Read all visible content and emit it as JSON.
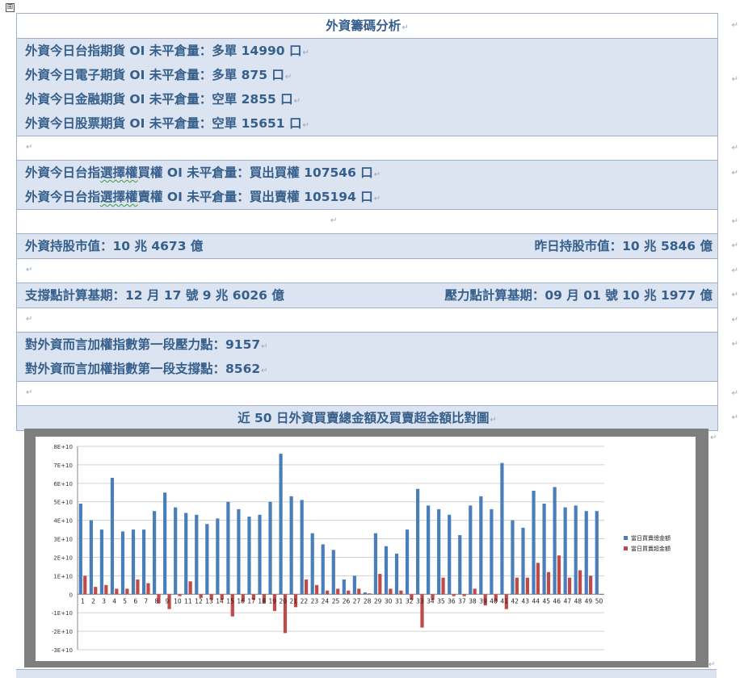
{
  "doc": {
    "move_handle": "⊞",
    "para_mark": "↵",
    "title": "外資籌碼分析",
    "futures": [
      {
        "prefix": "外資今日台指期貨 OI 未平倉量：",
        "value": "多單 14990 口"
      },
      {
        "prefix": "外資今日電子期貨 OI 未平倉量：",
        "value": "多單 875 口"
      },
      {
        "prefix": "外資今日金融期貨 OI 未平倉量：",
        "value": "空單 2855 口"
      },
      {
        "prefix": "外資今日股票期貨 OI 未平倉量：",
        "value": "空單 15651 口"
      }
    ],
    "options": [
      {
        "a": "外資今日台指",
        "b": "選擇權",
        "c": "買權 OI 未平倉量：買出買權 107546 口"
      },
      {
        "a": "外資今日台指",
        "b": "選擇權",
        "c": "賣權 OI 未平倉量：買出賣權 105194 口"
      }
    ],
    "holdings": {
      "left": "外資持股市值：10 兆 4673 億",
      "right": "昨日持股市值：10 兆 5846 億"
    },
    "base": {
      "left": "支撐點計算基期：12 月 17 號 9 兆 6026 億",
      "right": "壓力點計算基期：09 月 01 號 10 兆 1977 億"
    },
    "points": [
      "對外資而言加權指數第一段壓力點：9157",
      "對外資而言加權指數第一段支撐點：8562"
    ],
    "chart_title": "近 50 日外資買賣總金額及買賣超金額比對圖"
  },
  "chart_data": {
    "type": "bar",
    "categories": [
      "1",
      "2",
      "3",
      "4",
      "5",
      "6",
      "7",
      "8",
      "9",
      "10",
      "11",
      "12",
      "13",
      "14",
      "15",
      "16",
      "17",
      "18",
      "19",
      "20",
      "21",
      "22",
      "23",
      "24",
      "25",
      "26",
      "27",
      "28",
      "29",
      "30",
      "31",
      "32",
      "33",
      "34",
      "35",
      "36",
      "37",
      "38",
      "39",
      "40",
      "41",
      "42",
      "43",
      "44",
      "45",
      "46",
      "47",
      "48",
      "49",
      "50"
    ],
    "series": [
      {
        "name": "當日買賣總金額",
        "color": "#4a7ebb",
        "values": [
          49000000000.0,
          40000000000.0,
          35000000000.0,
          63000000000.0,
          34000000000.0,
          35000000000.0,
          35000000000.0,
          45000000000.0,
          55000000000.0,
          47000000000.0,
          44000000000.0,
          43000000000.0,
          38000000000.0,
          41000000000.0,
          50000000000.0,
          46000000000.0,
          42000000000.0,
          43000000000.0,
          50000000000.0,
          76000000000.0,
          53000000000.0,
          51000000000.0,
          33000000000.0,
          27000000000.0,
          24000000000.0,
          8000000000.0,
          10000000000.0,
          1000000000.0,
          33000000000.0,
          26000000000.0,
          22000000000.0,
          35000000000.0,
          57000000000.0,
          48000000000.0,
          46000000000.0,
          43000000000.0,
          32000000000.0,
          48000000000.0,
          53000000000.0,
          46000000000.0,
          71000000000.0,
          40000000000.0,
          36000000000.0,
          56000000000.0,
          49000000000.0,
          58000000000.0,
          47000000000.0,
          48000000000.0,
          45000000000.0,
          45000000000.0
        ]
      },
      {
        "name": "當日買賣超金額",
        "color": "#be4b48",
        "values": [
          10000000000.0,
          4000000000.0,
          5000000000.0,
          3000000000.0,
          3000000000.0,
          8000000000.0,
          6000000000.0,
          -5000000000.0,
          -8000000000.0,
          -1000000000.0,
          7000000000.0,
          -2000000000.0,
          -3000000000.0,
          -3000000000.0,
          -12000000000.0,
          -4000000000.0,
          -3000000000.0,
          -5000000000.0,
          -9000000000.0,
          -21000000000.0,
          -7000000000.0,
          8000000000.0,
          5000000000.0,
          2000000000.0,
          3000000000.0,
          2000000000.0,
          3000000000.0,
          500000000.0,
          11000000000.0,
          3000000000.0,
          2000000000.0,
          -3000000000.0,
          -18000000000.0,
          -3000000000.0,
          9000000000.0,
          -1000000000.0,
          -1000000000.0,
          3000000000.0,
          -6000000000.0,
          -4000000000.0,
          -8000000000.0,
          9000000000.0,
          9000000000.0,
          17000000000.0,
          12000000000.0,
          21000000000.0,
          9000000000.0,
          13000000000.0,
          10000000000.0,
          0.0
        ]
      }
    ],
    "ylim": [
      -30000000000.0,
      80000000000.0
    ],
    "yticks": [
      "8E+10",
      "7E+10",
      "6E+10",
      "5E+10",
      "4E+10",
      "3E+10",
      "2E+10",
      "1E+10",
      "0",
      "-1E+10",
      "-2E+10",
      "-3E+10"
    ],
    "legend_position": "right",
    "grid": true
  }
}
